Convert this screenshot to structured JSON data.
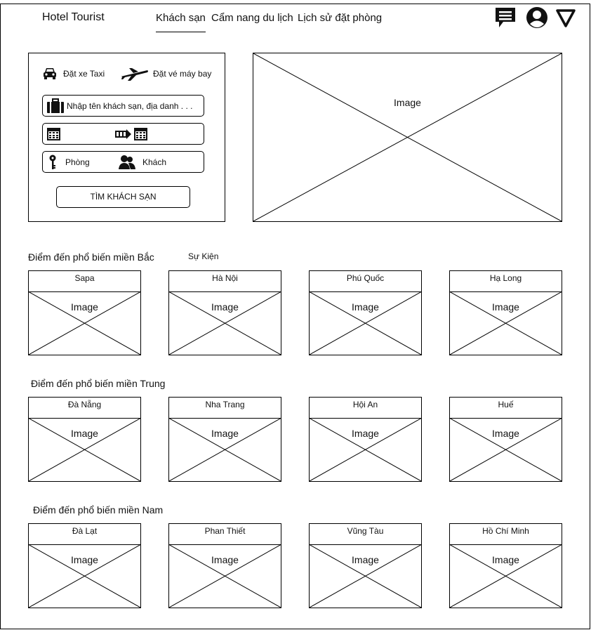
{
  "header": {
    "brand": "Hotel Tourist",
    "nav": [
      {
        "label": "Khách sạn",
        "active": true
      },
      {
        "label": "Cẩm nang du lịch",
        "active": false
      },
      {
        "label": "Lịch sử đặt phòng",
        "active": false
      }
    ],
    "icons": [
      "chat-icon",
      "user-icon",
      "dropdown-triangle-icon"
    ]
  },
  "search_panel": {
    "taxi_label": "Đặt xe Taxi",
    "flight_label": "Đặt vé máy bay",
    "destination_placeholder": "Nhập tên khách sạn, địa danh . . .",
    "room_label": "Phòng",
    "guest_label": "Khách",
    "search_button": "TÌM KHÁCH SẠN"
  },
  "hero": {
    "image_label": "Image"
  },
  "sections": [
    {
      "title": "Điểm đến phổ biến miền Bắc",
      "extra_link": "Sự Kiện",
      "cards": [
        {
          "title": "Sapa",
          "image_label": "Image"
        },
        {
          "title": "Hà Nội",
          "image_label": "Image"
        },
        {
          "title": "Phú Quốc",
          "image_label": "Image"
        },
        {
          "title": "Hạ Long",
          "image_label": "Image"
        }
      ]
    },
    {
      "title": "Điểm đến phổ biến miền Trung",
      "cards": [
        {
          "title": "Đà Nẵng",
          "image_label": "Image"
        },
        {
          "title": "Nha Trang",
          "image_label": "Image"
        },
        {
          "title": "Hội An",
          "image_label": "Image"
        },
        {
          "title": "Huế",
          "image_label": "Image"
        }
      ]
    },
    {
      "title": "Điểm đến phổ biến miền Nam",
      "cards": [
        {
          "title": "Đà Lạt",
          "image_label": "Image"
        },
        {
          "title": "Phan Thiết",
          "image_label": "Image"
        },
        {
          "title": "Vũng Tàu",
          "image_label": "Image"
        },
        {
          "title": "Hồ Chí Minh",
          "image_label": "Image"
        }
      ]
    }
  ]
}
